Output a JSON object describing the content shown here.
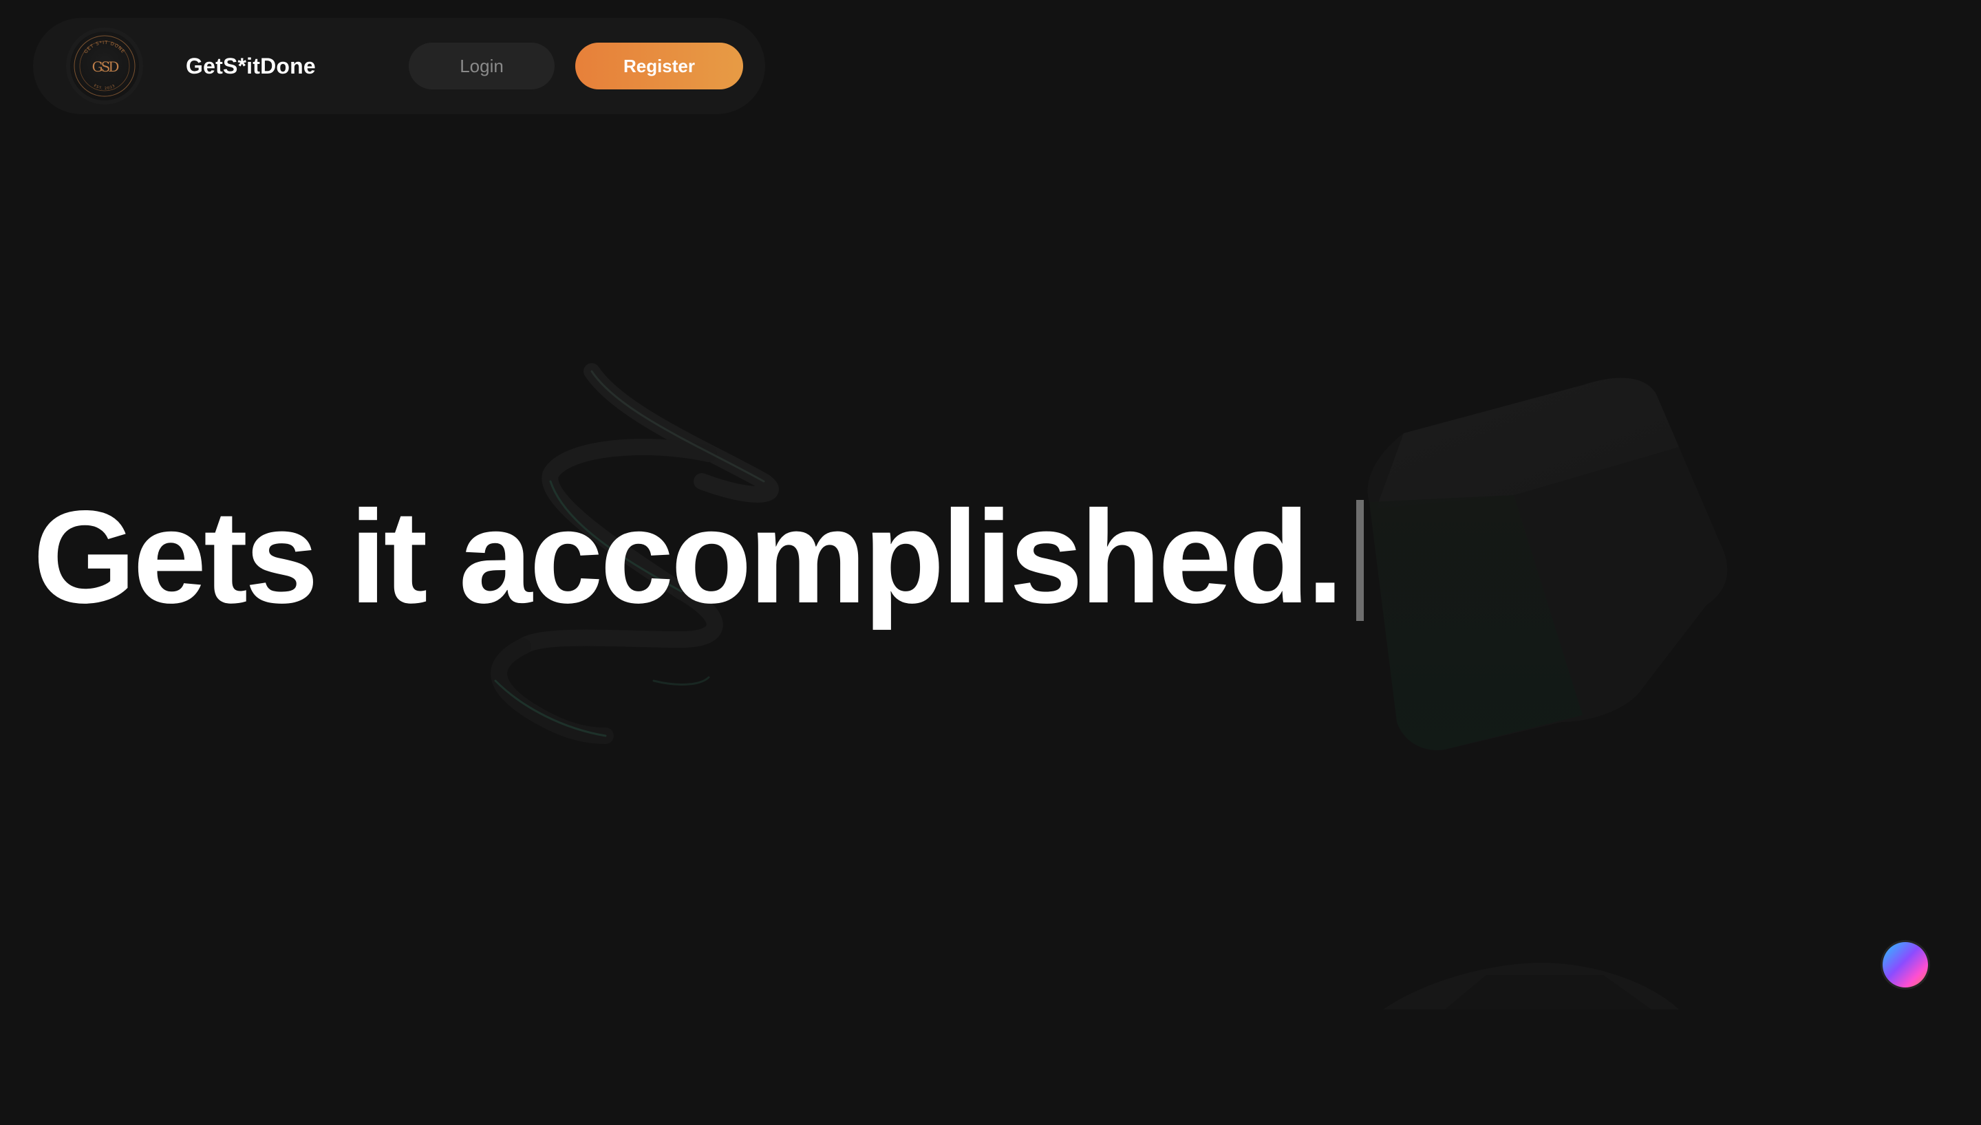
{
  "header": {
    "brand_name": "GetS*itDone",
    "login_label": "Login",
    "register_label": "Register",
    "logo": {
      "icon": "gsd-emblem-logo",
      "ring_text_top": "GET S*IT DONE",
      "monogram": "GSD",
      "ring_text_bottom": "EST. 2023"
    }
  },
  "hero": {
    "headline": "Gets it accomplished."
  },
  "floating_widget": {
    "icon": "gradient-orb-icon"
  },
  "colors": {
    "background": "#121212",
    "nav_background": "#181818",
    "accent_orange": "#e7803a",
    "headline": "#ffffff"
  }
}
